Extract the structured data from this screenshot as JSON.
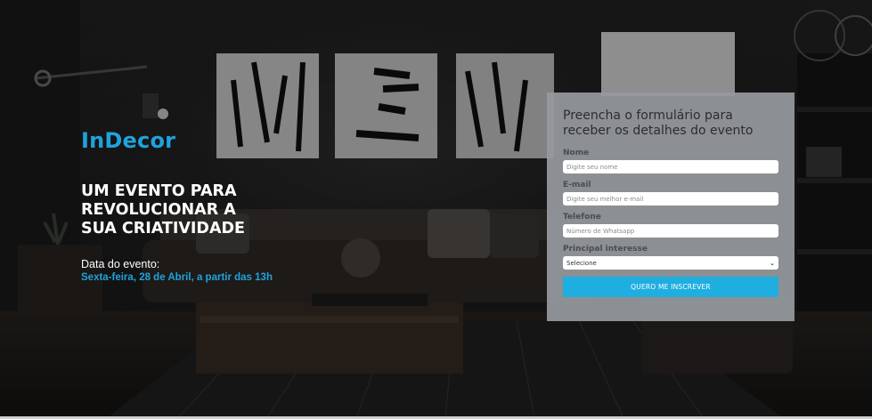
{
  "hero": {
    "brand": "InDecor",
    "headline_lines": [
      "UM EVENTO PARA",
      "REVOLUCIONAR A",
      "SUA CRIATIVIDADE"
    ],
    "date_label": "Data do evento:",
    "date_value": "Sexta-feira, 28 de Abril, a partir das 13h"
  },
  "form": {
    "title_lines": [
      "Preencha o formulário para",
      "receber os detalhes do evento"
    ],
    "name_label": "Nome",
    "name_placeholder": "Digite seu nome",
    "email_label": "E-mail",
    "email_placeholder": "Digite seu melhor e-mail",
    "phone_label": "Telefone",
    "phone_placeholder": "Número de Whatsapp",
    "interest_label": "Principal interesse",
    "interest_selected": "Selecione",
    "submit_label": "QUERO ME INSCREVER"
  },
  "colors": {
    "accent": "#1fa3dc",
    "button": "#1faee0",
    "panel": "#969a9e"
  },
  "icons": [
    "chevron-down-icon"
  ]
}
